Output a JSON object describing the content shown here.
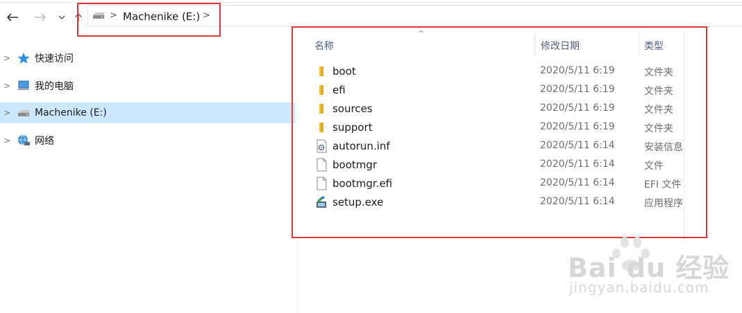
{
  "nav": {
    "back_icon": "back-arrow-icon",
    "forward_icon": "forward-arrow-icon",
    "recent_icon": "chevron-down-icon",
    "up_icon": "up-arrow-icon"
  },
  "address": {
    "drive_icon": "drive-icon",
    "path": "Machenike (E:)"
  },
  "sidebar": {
    "items": [
      {
        "label": "快速访问",
        "icon": "star-icon"
      },
      {
        "label": "我的电脑",
        "icon": "computer-icon"
      },
      {
        "label": "Machenike (E:)",
        "icon": "drive-icon",
        "selected": true
      },
      {
        "label": "网络",
        "icon": "network-icon"
      }
    ]
  },
  "columns": {
    "name": "名称",
    "modified": "修改日期",
    "type": "类型"
  },
  "files": [
    {
      "name": "boot",
      "date": "2020/5/11 6:19",
      "type": "文件夹",
      "icon": "folder-icon"
    },
    {
      "name": "efi",
      "date": "2020/5/11 6:19",
      "type": "文件夹",
      "icon": "folder-icon"
    },
    {
      "name": "sources",
      "date": "2020/5/11 6:19",
      "type": "文件夹",
      "icon": "folder-icon"
    },
    {
      "name": "support",
      "date": "2020/5/11 6:19",
      "type": "文件夹",
      "icon": "folder-icon"
    },
    {
      "name": "autorun.inf",
      "date": "2020/5/11 6:14",
      "type": "安装信息",
      "icon": "settings-file-icon"
    },
    {
      "name": "bootmgr",
      "date": "2020/5/11 6:14",
      "type": "文件",
      "icon": "file-icon"
    },
    {
      "name": "bootmgr.efi",
      "date": "2020/5/11 6:14",
      "type": "EFI 文件",
      "icon": "file-icon"
    },
    {
      "name": "setup.exe",
      "date": "2020/5/11 6:14",
      "type": "应用程序",
      "icon": "setup-exe-icon"
    }
  ],
  "watermark": {
    "brand": "Bai du 经验",
    "url": "jingyan.baidu.com"
  },
  "colors": {
    "highlight_box": "#e0343a",
    "selected_bg": "#cce8ff",
    "header_text": "#4d6082",
    "folder": "#f5c542"
  }
}
